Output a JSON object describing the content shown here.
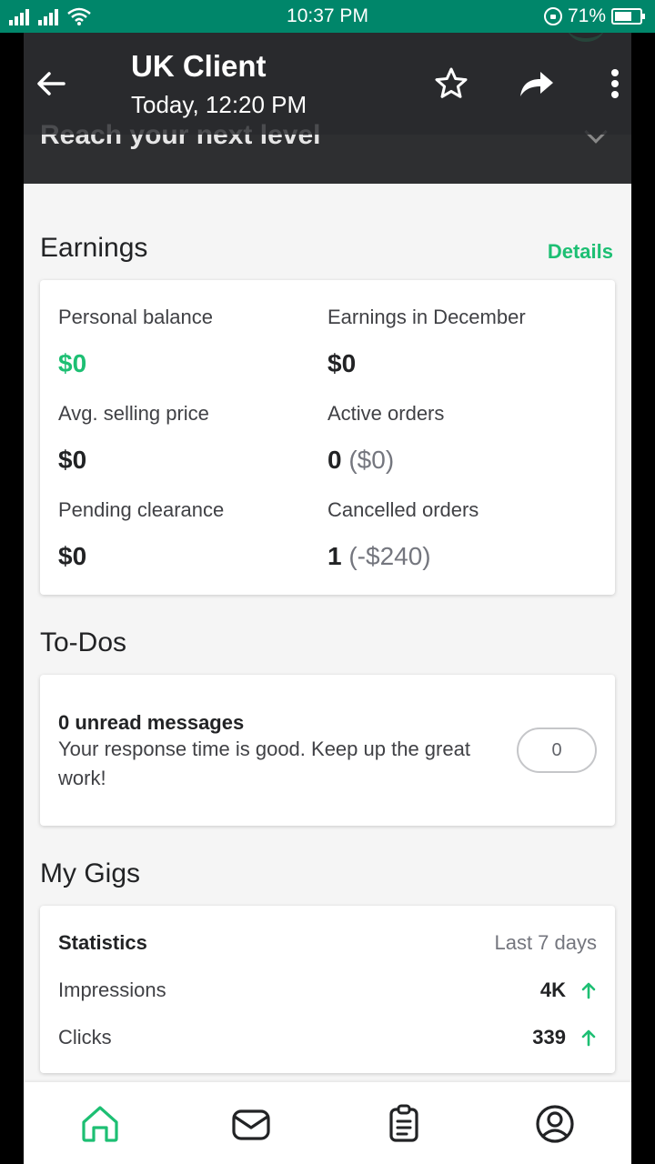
{
  "status_bar": {
    "time": "10:37 PM",
    "battery": "71%",
    "battery_level": 0.71
  },
  "header": {
    "title": "UK Client",
    "subtitle": "Today, 12:20 PM",
    "underlying_banner": "Reach your next level"
  },
  "earnings": {
    "title": "Earnings",
    "details_label": "Details",
    "personal_balance_label": "Personal balance",
    "personal_balance_value": "$0",
    "earnings_month_label": "Earnings in December",
    "earnings_month_value": "$0",
    "avg_price_label": "Avg. selling price",
    "avg_price_value": "$0",
    "active_orders_label": "Active orders",
    "active_orders_count": "0",
    "active_orders_amount": "($0)",
    "pending_label": "Pending clearance",
    "pending_value": "$0",
    "cancelled_label": "Cancelled orders",
    "cancelled_count": "1",
    "cancelled_amount": "(-$240)"
  },
  "todos": {
    "title": "To-Dos",
    "unread_heading": "0 unread messages",
    "unread_body": "Your response time is good. Keep up the great work!",
    "unread_count": "0"
  },
  "gigs": {
    "title": "My Gigs",
    "stats_label": "Statistics",
    "period_label": "Last 7 days",
    "impressions_label": "Impressions",
    "impressions_value": "4K",
    "clicks_label": "Clicks",
    "clicks_value": "339"
  },
  "colors": {
    "accent": "#1dbf73",
    "status_bar": "#00866a",
    "header_overlay": "#2e2f31"
  },
  "icons": [
    "back-arrow-icon",
    "star-icon",
    "share-icon",
    "more-vertical-icon",
    "home-icon",
    "messages-icon",
    "orders-icon",
    "profile-icon"
  ]
}
